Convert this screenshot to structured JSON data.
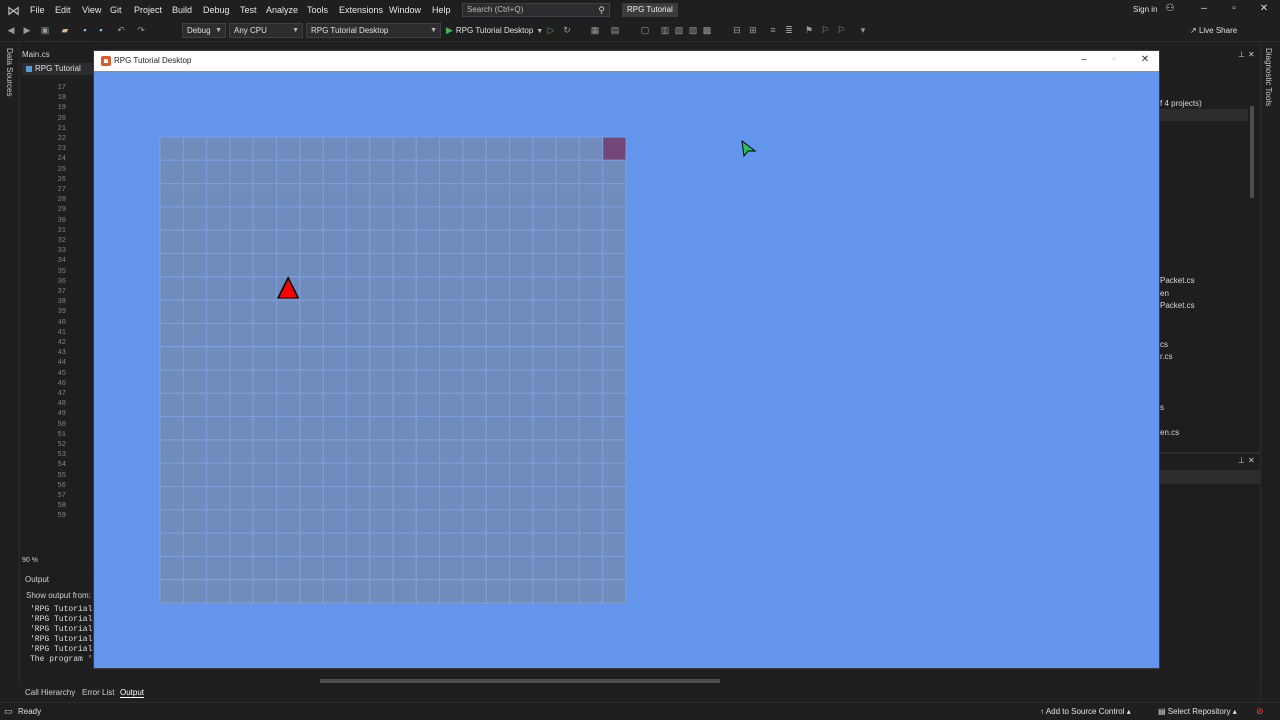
{
  "menubar": {
    "logo_icon": "visual-studio-logo-icon",
    "items": [
      "File",
      "Edit",
      "View",
      "Git",
      "Project",
      "Build",
      "Debug",
      "Test",
      "Analyze",
      "Tools",
      "Extensions",
      "Window",
      "Help"
    ],
    "search_placeholder": "Search (Ctrl+Q)",
    "solution_name": "RPG Tutorial",
    "sign_in": "Sign in"
  },
  "toolbar": {
    "configuration": "Debug",
    "platform": "Any CPU",
    "startup_project": "RPG Tutorial Desktop",
    "run_target": "RPG Tutorial Desktop",
    "live_share": "Live Share"
  },
  "left": {
    "data_sources_tab": "Data Sources"
  },
  "editor": {
    "tab": "Main.cs",
    "file_tab": "RPG Tutorial",
    "line_numbers": [
      "17",
      "18",
      "19",
      "20",
      "21",
      "22",
      "23",
      "24",
      "25",
      "26",
      "27",
      "28",
      "29",
      "30",
      "31",
      "32",
      "33",
      "34",
      "35",
      "36",
      "37",
      "38",
      "39",
      "40",
      "41",
      "42",
      "43",
      "44",
      "45",
      "46",
      "47",
      "48",
      "49",
      "50",
      "51",
      "52",
      "53",
      "54",
      "55",
      "56",
      "57",
      "58",
      "59"
    ],
    "zoom": "90 %"
  },
  "output": {
    "title": "Output",
    "show_from": "Show output from:",
    "lines": [
      "'RPG Tutorial",
      "'RPG Tutorial",
      "'RPG Tutorial",
      "'RPG Tutorial",
      "'RPG Tutorial",
      "The program '["
    ]
  },
  "bottom_tabs": [
    "Call Hierarchy",
    "Error List",
    "Output"
  ],
  "status": {
    "ready": "Ready",
    "add_to_source_control": "Add to Source Control",
    "select_repository": "Select Repository"
  },
  "right": {
    "diagnostic_tools_tab": "Diagnostic Tools",
    "solution_header": "f 4 projects)",
    "items": [
      "Packet.cs",
      "en",
      "Packet.cs",
      "cs",
      "r.cs",
      "s",
      "en.cs"
    ]
  },
  "game": {
    "title": "RPG Tutorial Desktop",
    "background_color": "#6495ed",
    "grid": {
      "columns": 20,
      "rows": 20,
      "cell_color": "#708cbc",
      "line_color": "#7d9fdc",
      "highlight_cell": {
        "column": 20,
        "row": 1,
        "color": "#734878"
      },
      "player_cell": {
        "column": 6,
        "row": 7,
        "shape": "red-triangle",
        "color": "#ff0000"
      }
    },
    "cursor": {
      "color": "#22c45a",
      "icon": "green-arrow-cursor-icon"
    }
  }
}
